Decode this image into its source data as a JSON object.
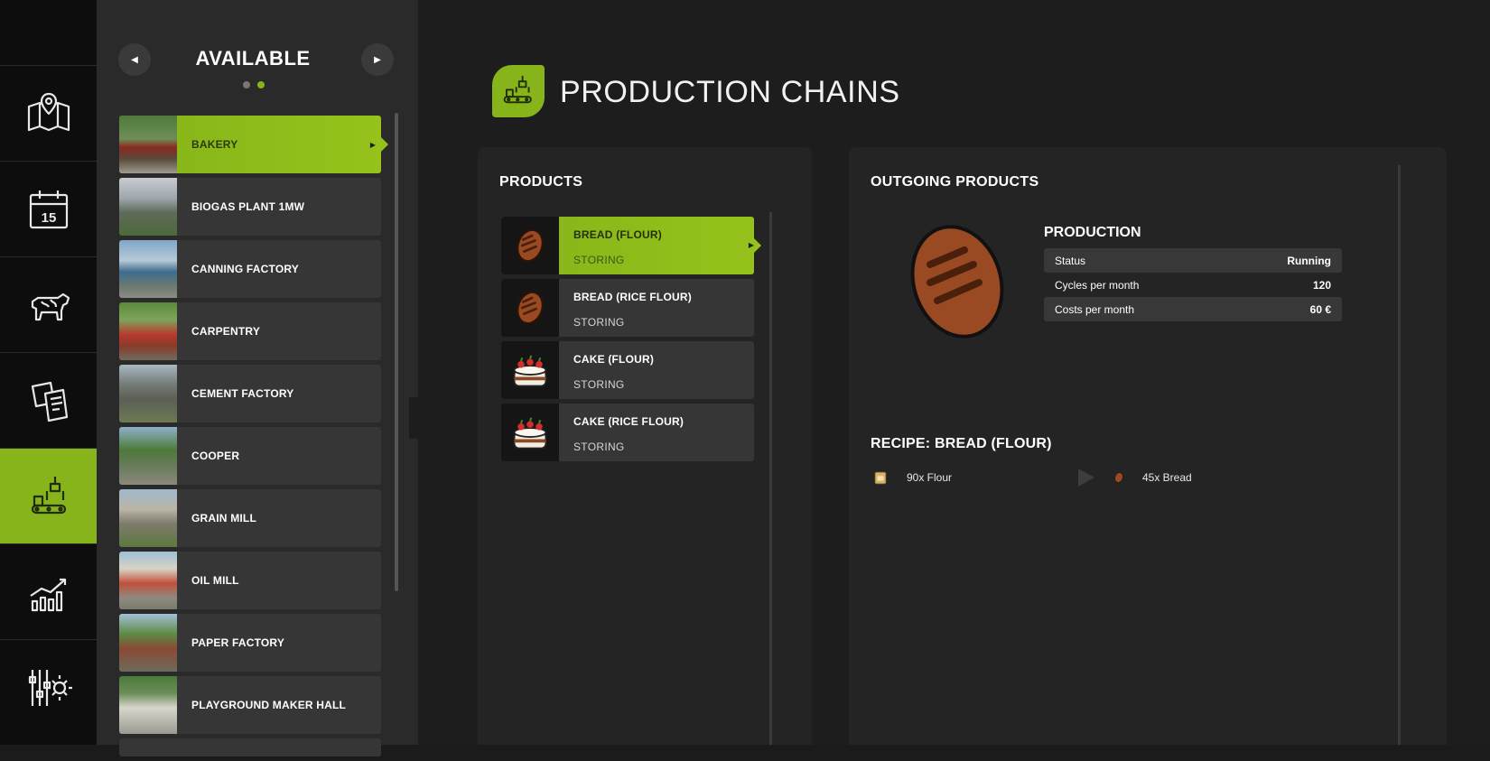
{
  "rail": {
    "items": [
      {
        "icon": "map-icon"
      },
      {
        "icon": "calendar-icon",
        "day": "15"
      },
      {
        "icon": "cow-icon"
      },
      {
        "icon": "contracts-icon"
      },
      {
        "icon": "production-icon",
        "active": true
      },
      {
        "icon": "statistics-icon"
      },
      {
        "icon": "settings-icon"
      }
    ]
  },
  "available": {
    "title": "AVAILABLE",
    "items": [
      {
        "label": "BAKERY",
        "active": true
      },
      {
        "label": "BIOGAS PLANT 1MW"
      },
      {
        "label": "CANNING FACTORY"
      },
      {
        "label": "CARPENTRY"
      },
      {
        "label": "CEMENT FACTORY"
      },
      {
        "label": "COOPER"
      },
      {
        "label": "GRAIN MILL"
      },
      {
        "label": "OIL MILL"
      },
      {
        "label": "PAPER FACTORY"
      },
      {
        "label": "PLAYGROUND MAKER HALL"
      }
    ]
  },
  "page": {
    "title": "PRODUCTION CHAINS"
  },
  "products": {
    "title": "PRODUCTS",
    "items": [
      {
        "name": "BREAD (FLOUR)",
        "status": "STORING",
        "icon": "bread-icon",
        "active": true
      },
      {
        "name": "BREAD (RICE FLOUR)",
        "status": "STORING",
        "icon": "bread-icon"
      },
      {
        "name": "CAKE (FLOUR)",
        "status": "STORING",
        "icon": "cake-icon"
      },
      {
        "name": "CAKE (RICE FLOUR)",
        "status": "STORING",
        "icon": "cake-icon"
      }
    ]
  },
  "outgoing": {
    "title": "OUTGOING PRODUCTS",
    "production": {
      "title": "PRODUCTION",
      "stats": [
        {
          "label": "Status",
          "value": "Running"
        },
        {
          "label": "Cycles per month",
          "value": "120"
        },
        {
          "label": "Costs per month",
          "value": "60 €"
        }
      ]
    },
    "recipe": {
      "title": "RECIPE: BREAD (FLOUR)",
      "input": "90x Flour",
      "output": "45x Bread"
    }
  },
  "colors": {
    "accent": "#86b41a",
    "bread": "#9a4a22"
  }
}
